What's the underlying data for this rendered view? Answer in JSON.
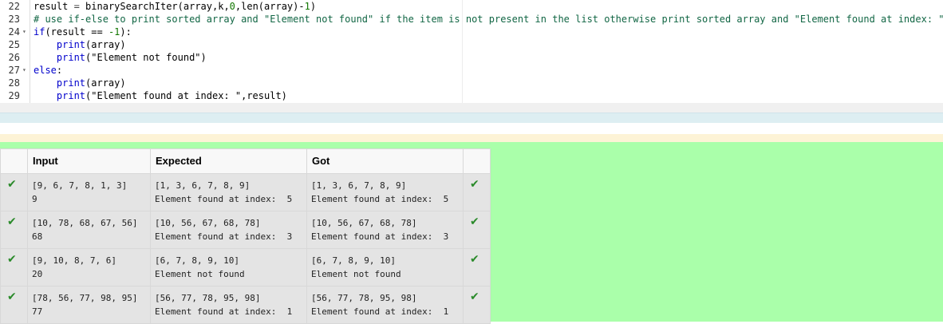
{
  "editor": {
    "lines": [
      {
        "num": "22",
        "fold": false,
        "parts": [
          [
            "result",
            "t-str"
          ],
          [
            " = ",
            "t-op"
          ],
          [
            "binarySearchIter(array,k,",
            "t-str"
          ],
          [
            "0",
            "t-num"
          ],
          [
            ",len(array)-",
            "t-str"
          ],
          [
            "1",
            "t-num"
          ],
          [
            ")",
            "t-str"
          ]
        ]
      },
      {
        "num": "23",
        "fold": false,
        "parts": [
          [
            "# use if-else to print sorted array and \"Element not found\" if the item is not present in the list otherwise print sorted array and \"Element found at index: \", result",
            "t-cmt"
          ]
        ]
      },
      {
        "num": "24",
        "fold": true,
        "parts": [
          [
            "if",
            "t-kw"
          ],
          [
            "(result == ",
            "t-str"
          ],
          [
            "-1",
            "t-num"
          ],
          [
            "):",
            "t-str"
          ]
        ]
      },
      {
        "num": "25",
        "fold": false,
        "parts": [
          [
            "    ",
            "t-str"
          ],
          [
            "print",
            "t-kw"
          ],
          [
            "(array)",
            "t-str"
          ]
        ]
      },
      {
        "num": "26",
        "fold": false,
        "parts": [
          [
            "    ",
            "t-str"
          ],
          [
            "print",
            "t-kw"
          ],
          [
            "(\"Element not found\")",
            "t-str"
          ]
        ]
      },
      {
        "num": "27",
        "fold": true,
        "parts": [
          [
            "else",
            "t-kw"
          ],
          [
            ":",
            "t-str"
          ]
        ]
      },
      {
        "num": "28",
        "fold": false,
        "parts": [
          [
            "    ",
            "t-str"
          ],
          [
            "print",
            "t-kw"
          ],
          [
            "(array)",
            "t-str"
          ]
        ]
      },
      {
        "num": "29",
        "fold": false,
        "parts": [
          [
            "    ",
            "t-str"
          ],
          [
            "print",
            "t-kw"
          ],
          [
            "(\"Element found at index: \",result)",
            "t-str"
          ]
        ]
      }
    ]
  },
  "results": {
    "headers": [
      "",
      "Input",
      "Expected",
      "Got",
      ""
    ],
    "rows": [
      {
        "input": "[9, 6, 7, 8, 1, 3]\n9",
        "expected": "[1, 3, 6, 7, 8, 9]\nElement found at index:  5",
        "got": "[1, 3, 6, 7, 8, 9]\nElement found at index:  5"
      },
      {
        "input": "[10, 78, 68, 67, 56]\n68",
        "expected": "[10, 56, 67, 68, 78]\nElement found at index:  3",
        "got": "[10, 56, 67, 68, 78]\nElement found at index:  3"
      },
      {
        "input": "[9, 10, 8, 7, 6]\n20",
        "expected": "[6, 7, 8, 9, 10]\nElement not found",
        "got": "[6, 7, 8, 9, 10]\nElement not found"
      },
      {
        "input": "[78, 56, 77, 98, 95]\n77",
        "expected": "[56, 77, 78, 95, 98]\nElement found at index:  1",
        "got": "[56, 77, 78, 95, 98]\nElement found at index:  1"
      }
    ],
    "check_icon": "check-icon",
    "colors": {
      "pass_bg": "#aaffaa",
      "check": "#2a8a2a"
    }
  }
}
